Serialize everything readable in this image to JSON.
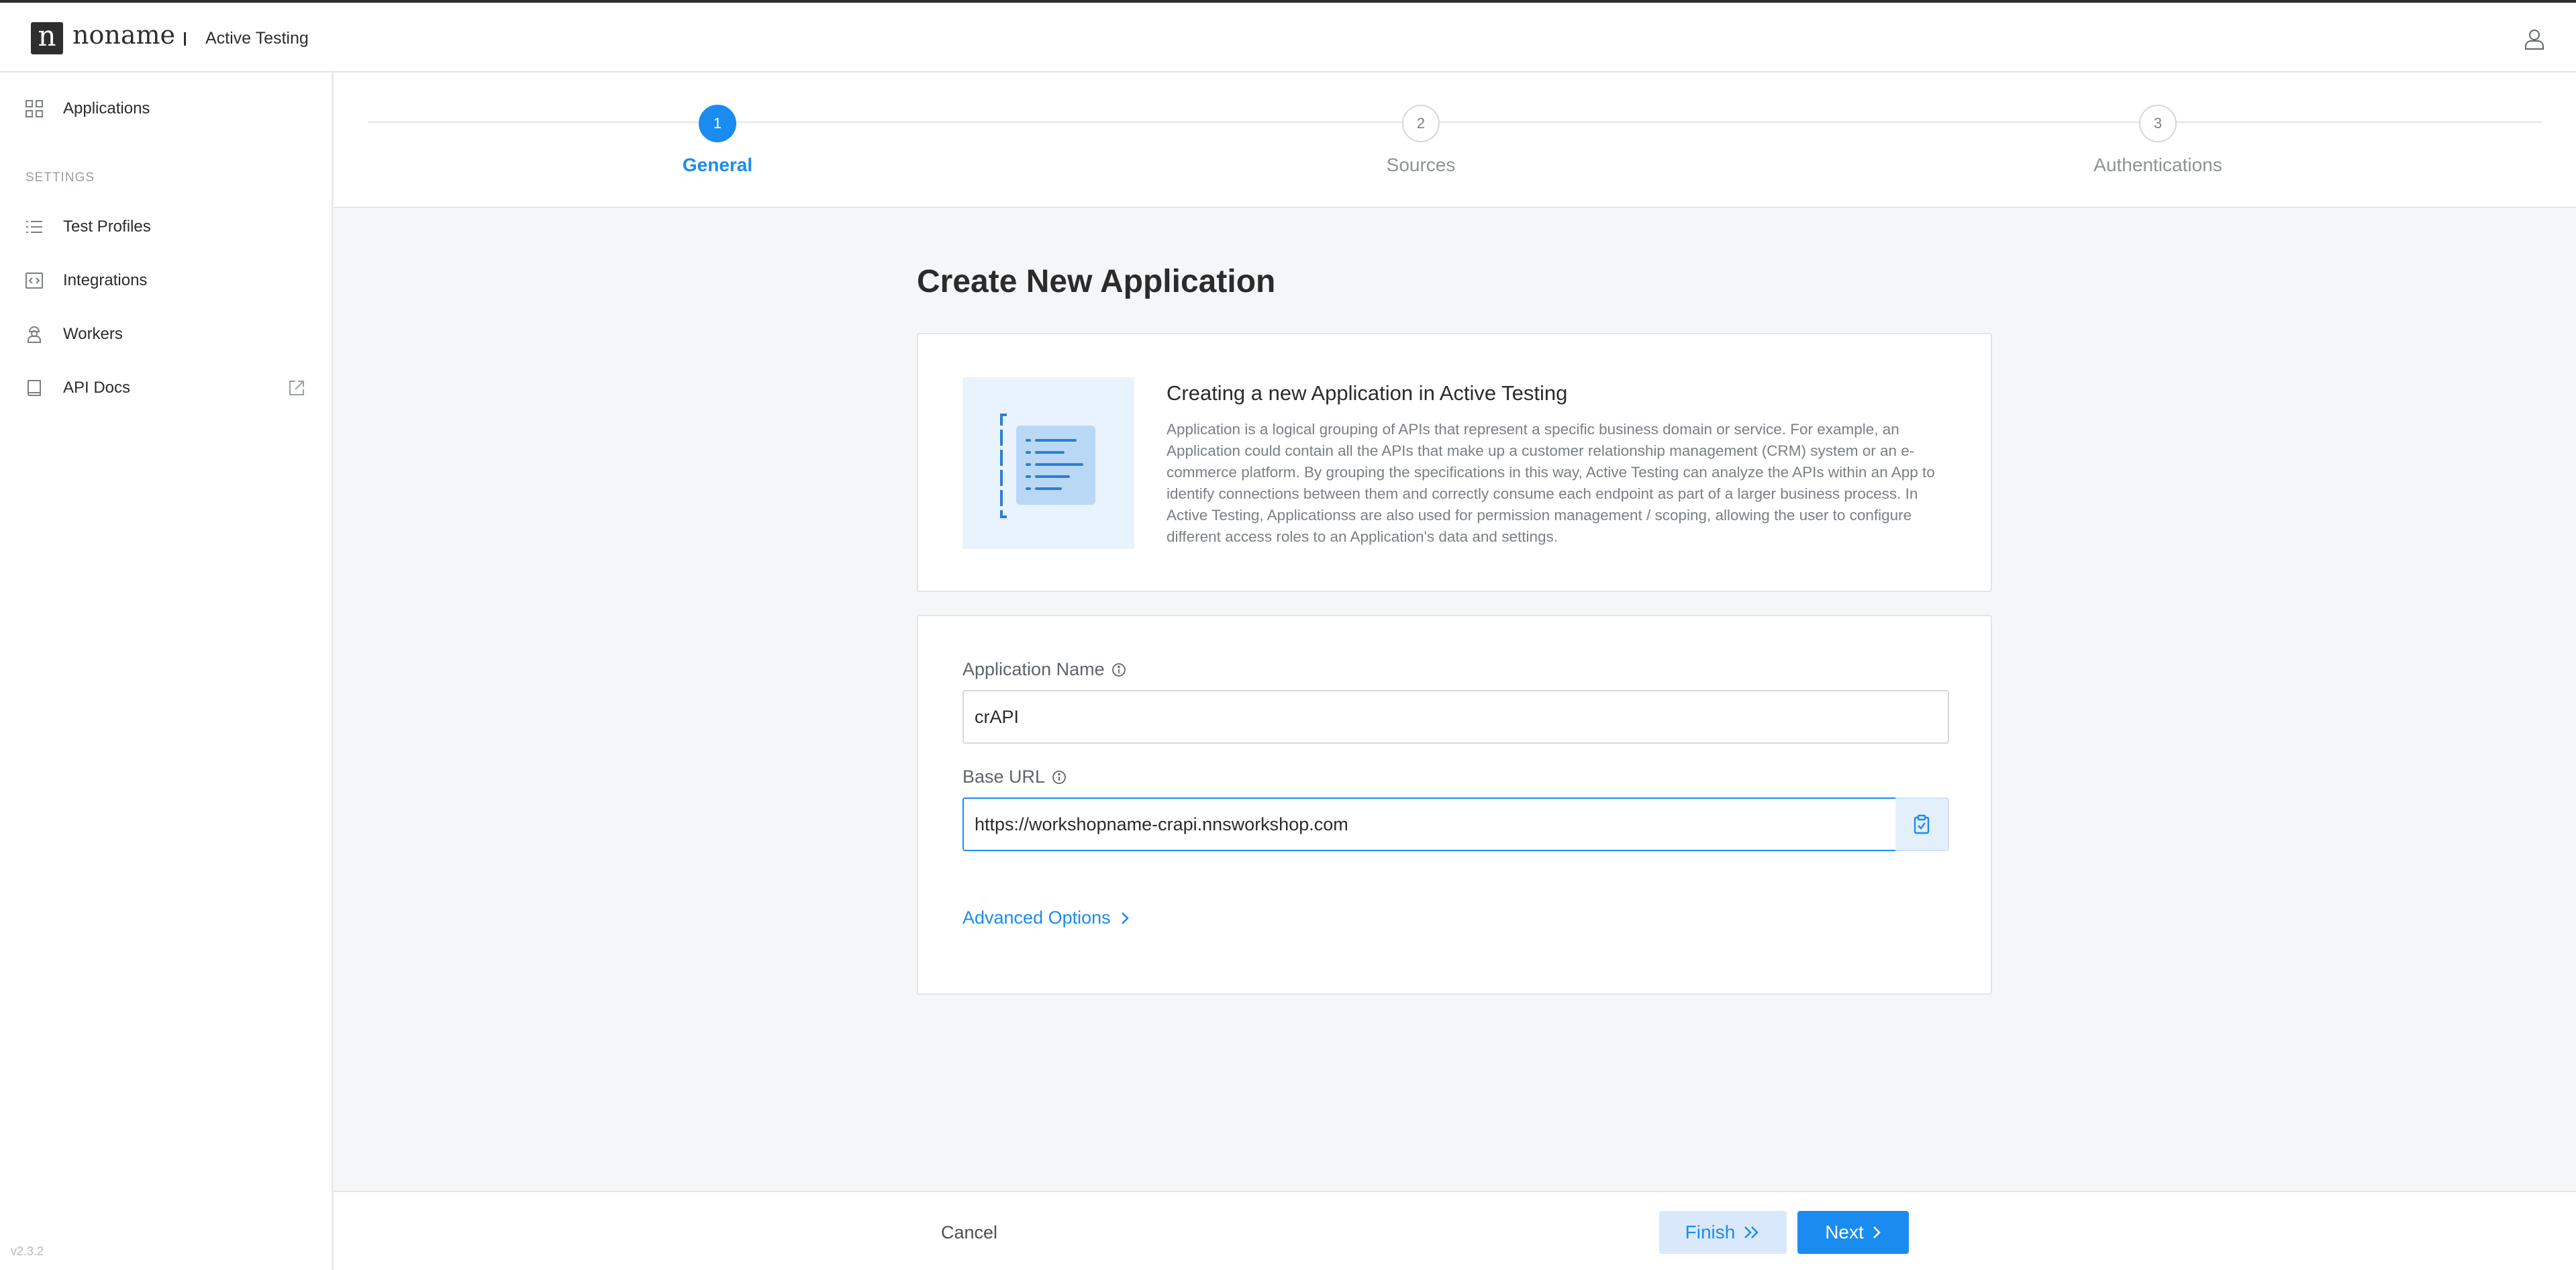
{
  "header": {
    "logo_letter": "n",
    "brand": "noname",
    "product": "Active Testing"
  },
  "sidebar": {
    "items": [
      {
        "label": "Applications",
        "icon": "grid-icon"
      },
      {
        "label": "Test Profiles",
        "icon": "list-icon"
      },
      {
        "label": "Integrations",
        "icon": "code-icon"
      },
      {
        "label": "Workers",
        "icon": "worker-icon"
      },
      {
        "label": "API Docs",
        "icon": "book-icon"
      }
    ],
    "section_settings": "SETTINGS",
    "version": "v2.3.2"
  },
  "stepper": {
    "steps": [
      {
        "number": "1",
        "label": "General",
        "active": true
      },
      {
        "number": "2",
        "label": "Sources",
        "active": false
      },
      {
        "number": "3",
        "label": "Authentications",
        "active": false
      }
    ]
  },
  "main": {
    "title": "Create New Application",
    "info": {
      "title": "Creating a new Application in Active Testing",
      "body": "Application is a logical grouping of APIs that represent a specific business domain or service. For example, an Application could contain all the APIs that make up a customer relationship management (CRM) system or an e-commerce platform. By grouping the specifications in this way, Active Testing can analyze the APIs within an App to identify connections between them and correctly consume each endpoint as part of a larger business process. In Active Testing, Applicationss are also used for permission management / scoping, allowing the user to configure different access roles to an Application's data and settings."
    },
    "form": {
      "app_name_label": "Application Name",
      "app_name_value": "crAPI",
      "base_url_label": "Base URL",
      "base_url_value": "https://workshopname-crapi.nnsworkshop.com",
      "advanced_options": "Advanced Options"
    }
  },
  "footer": {
    "cancel": "Cancel",
    "finish": "Finish",
    "next": "Next"
  },
  "colors": {
    "accent": "#1a8cf0",
    "accent_light": "#d9e9fb",
    "border": "#e3e5e8",
    "background": "#f5f6f8"
  }
}
